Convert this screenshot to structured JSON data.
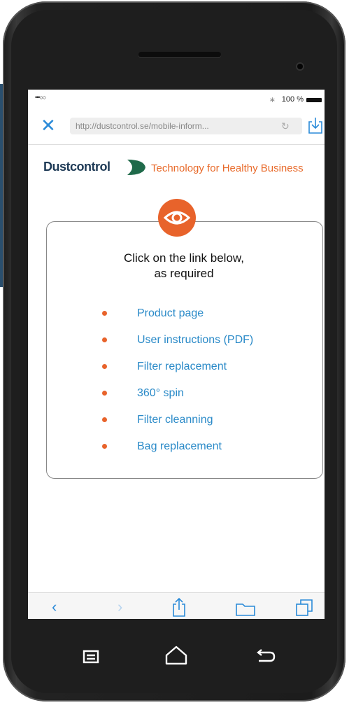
{
  "status": {
    "signal": "•••○○",
    "bluetooth": "∗",
    "battery": "100 %"
  },
  "browser": {
    "url": "http://dustcontrol.se/mobile-inform..."
  },
  "brand": {
    "logo_text": "Dustcontrol",
    "tagline": "Technology for Healthy Business"
  },
  "card": {
    "title_line1": "Click on the link below,",
    "title_line2": "as required",
    "links": [
      "Product page",
      "User instructions (PDF)",
      "Filter replacement",
      "360° spin",
      "Filter cleanning",
      "Bag replacement"
    ]
  },
  "colors": {
    "accent": "#e8632b",
    "link": "#2a8ac8",
    "ios_blue": "#2a8ad8",
    "brand_navy": "#1e3a56"
  },
  "icons": {
    "close": "close-icon",
    "reload": "reload-icon",
    "download": "download-icon",
    "back": "back-icon",
    "forward": "forward-icon",
    "share": "share-icon",
    "bookmarks": "bookmarks-icon",
    "tabs": "tabs-icon",
    "eye": "eye-icon",
    "menu": "menu-icon",
    "home": "home-icon",
    "return": "return-icon"
  }
}
